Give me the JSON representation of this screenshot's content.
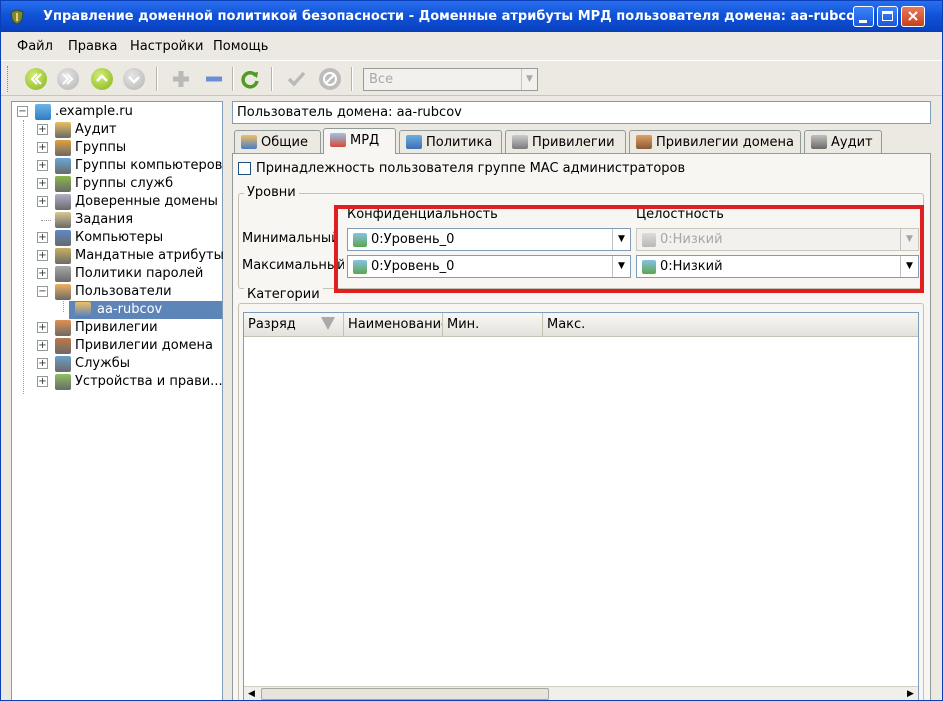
{
  "window": {
    "title": "Управление доменной политикой безопасности - Доменные атрибуты МРД пользователя домена: aa-rubcov"
  },
  "menu": [
    "Файл",
    "Правка",
    "Настройки",
    "Помощь"
  ],
  "toolbar": {
    "filter_value": "Все",
    "buttons": [
      "first-icon",
      "last-icon",
      "up-icon",
      "down-icon",
      "add-icon",
      "remove-icon",
      "refresh-icon",
      "apply-icon",
      "cancel-icon"
    ]
  },
  "tree": {
    "root": ".example.ru",
    "items": [
      "Аудит",
      "Группы",
      "Группы компьютеров",
      "Группы служб",
      "Доверенные домены",
      "Задания",
      "Компьютеры",
      "Мандатные атрибуты",
      "Политики паролей",
      "Пользователи",
      "Привилегии",
      "Привилегии домена",
      "Службы",
      "Устройства и прави..."
    ],
    "selected_child": "aa-rubcov"
  },
  "user_field": "Пользователь домена: aa-rubcov",
  "tabs": [
    "Общие",
    "МРД",
    "Политика",
    "Привилегии",
    "Привилегии домена",
    "Аудит"
  ],
  "active_tab": "МРД",
  "mac_admin_checkbox": {
    "label": "Принадлежность пользователя группе MAC администраторов",
    "checked": false
  },
  "levels": {
    "title": "Уровни",
    "col_confidentiality": "Конфиденциальность",
    "col_integrity": "Целостность",
    "min_label": "Минимальный",
    "max_label": "Максимальный:",
    "min_conf": "0:Уровень_0",
    "min_integrity": "0:Низкий",
    "max_conf": "0:Уровень_0",
    "max_integrity": "0:Низкий"
  },
  "categories": {
    "title": "Категории",
    "columns": [
      "Разряд",
      "Наименование",
      "Мин.",
      "Макс."
    ]
  },
  "colors": {
    "titlebar": "#1053d8",
    "selection": "#5e85b8",
    "highlight": "#e02020"
  }
}
